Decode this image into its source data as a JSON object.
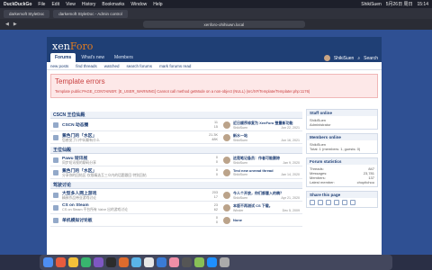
{
  "menubar": {
    "app": "DuckDuckGo",
    "items": [
      "File",
      "Edit",
      "View",
      "History",
      "Bookmarks",
      "Window",
      "Help"
    ],
    "user": "ShikiSuen",
    "date": "5月26日 周日",
    "time": "15:14"
  },
  "tabs": [
    {
      "label": "darkemoft StyleDoc"
    },
    {
      "label": "darkemoft StyleDoc - Admin control"
    }
  ],
  "address": {
    "url": "xenforo-ohihiuwn.local"
  },
  "header": {
    "logo_a": "xen",
    "logo_b": "Foro",
    "nav": [
      "Forums",
      "What's new",
      "Members"
    ],
    "user": "ShikiSuen",
    "search": "Search"
  },
  "subnav": [
    "new posts",
    "find threads",
    "watched",
    "search forums",
    "mark forums read"
  ],
  "error": {
    "title": "Template errors",
    "message": "Template public:PAGE_CONTAINER: [E_USER_WARNING] Cannot call method getMode on a non-object (NULL) (src/XF/Template/Templater.php:1176)"
  },
  "categories": [
    {
      "name": "CSCN 王位仙殿",
      "forums": [
        {
          "title": "CSCN 动态圈",
          "desc": "",
          "stats": [
            "11",
            "15"
          ],
          "last_title": "近日顺序修复为 XenForo 整量新功能",
          "last_user": "ShikiSuen",
          "last_time": "Jun 22, 2021"
        },
        {
          "title": "蕉色门的「水区」",
          "desc": "您感觉了口中闲聊有什么",
          "stats": [
            "21.3K",
            "48K"
          ],
          "last_title": "新水一站",
          "last_user": "ShikiSuen",
          "last_time": "Jun 16, 2021"
        }
      ]
    },
    {
      "name": "王位仙殿",
      "forums": [
        {
          "title": "Pawu 短讯视",
          "desc": "同步短讯视的聊码分享",
          "stats": [
            "0",
            "0"
          ],
          "last_title": "这是笔记备员：作者可能删除",
          "last_user": "ShikiSuen",
          "last_time": "Jan 9, 2020"
        },
        {
          "title": "蕉色门的「水区」",
          "desc": "分享你的回帖区·仅限精选互三众内的话题跟回·特别回帖",
          "stats": [
            "0",
            "0"
          ],
          "last_title": "Test new unread thread",
          "last_user": "ShikiSuen",
          "last_time": "Jan 14, 2020"
        }
      ]
    },
    {
      "name": "驾驶讨论",
      "forums": [
        {
          "title": "大型多人网上游戏",
          "desc": "精致作品带亚游戏讨论",
          "stats": [
            "203",
            "17"
          ],
          "last_title": "今人个开放，你们都塞入的稿？",
          "last_user": "ShikiSuen",
          "last_time": "Apr 21, 2020"
        },
        {
          "title": "CS on Steam",
          "desc": "CS on Steam 平台所有 Valve 出的游戏讨论",
          "stats": [
            "23",
            "62"
          ],
          "last_title": "本版不再测试 CS 下载。",
          "last_user": "Winder",
          "last_time": "Dec 5, 2009"
        },
        {
          "title": "单机模拟讨论板",
          "desc": "",
          "stats": [
            "0",
            "0"
          ],
          "last_title": "None",
          "last_user": "",
          "last_time": ""
        }
      ]
    }
  ],
  "sidebar": {
    "staff_online": {
      "title": "Staff online",
      "name": "ShikiSuen",
      "role": "Administrator"
    },
    "members_online": {
      "title": "Members online",
      "name": "ShikiSuen",
      "total": "Total: 1 (members: 1, guests: 0)"
    },
    "forum_stats": {
      "title": "Forum statistics",
      "rows": [
        [
          "Threads:",
          "847"
        ],
        [
          "Messages:",
          "23,781"
        ],
        [
          "Members:",
          "137"
        ],
        [
          "Latest member:",
          "chopitchou"
        ]
      ]
    },
    "share": {
      "title": "Share this page"
    }
  },
  "colors": {
    "accent": "#1f3f75",
    "error": "#c94141",
    "brand_orange": "#e37c1e"
  }
}
